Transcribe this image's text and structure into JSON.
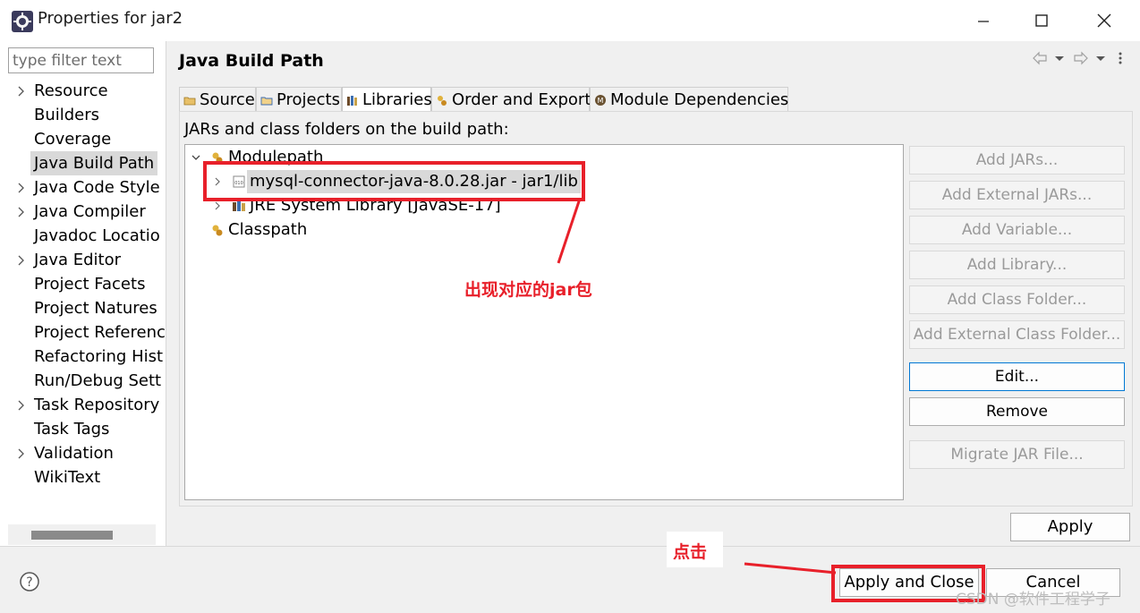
{
  "window": {
    "title": "Properties for jar2",
    "icons": [
      "eclipse-icon",
      "minimize-icon",
      "maximize-icon",
      "close-icon"
    ]
  },
  "nav": {
    "filter_placeholder": "type filter text",
    "items": [
      {
        "label": "Resource",
        "expandable": true
      },
      {
        "label": "Builders",
        "expandable": false
      },
      {
        "label": "Coverage",
        "expandable": false
      },
      {
        "label": "Java Build Path",
        "expandable": false,
        "selected": true
      },
      {
        "label": "Java Code Style",
        "expandable": true
      },
      {
        "label": "Java Compiler",
        "expandable": true
      },
      {
        "label": "Javadoc Locatio",
        "expandable": false
      },
      {
        "label": "Java Editor",
        "expandable": true
      },
      {
        "label": "Project Facets",
        "expandable": false
      },
      {
        "label": "Project Natures",
        "expandable": false
      },
      {
        "label": "Project Referenc",
        "expandable": false
      },
      {
        "label": "Refactoring Hist",
        "expandable": false
      },
      {
        "label": "Run/Debug Sett",
        "expandable": false
      },
      {
        "label": "Task Repository",
        "expandable": true
      },
      {
        "label": "Task Tags",
        "expandable": false
      },
      {
        "label": "Validation",
        "expandable": true
      },
      {
        "label": "WikiText",
        "expandable": false
      }
    ]
  },
  "page": {
    "title": "Java Build Path",
    "history_icons": [
      "back-arrow-icon",
      "dropdown-icon",
      "forward-arrow-icon",
      "dropdown-icon",
      "view-menu-icon"
    ],
    "tabs": [
      {
        "label": "Source",
        "icon": "source-folder-icon"
      },
      {
        "label": "Projects",
        "icon": "project-folder-icon"
      },
      {
        "label": "Libraries",
        "icon": "library-icon",
        "active": true
      },
      {
        "label": "Order and Export",
        "icon": "order-export-icon"
      },
      {
        "label": "Module Dependencies",
        "icon": "module-icon"
      }
    ],
    "section_label": "JARs and class folders on the build path:",
    "tree": {
      "modulepath": "Modulepath",
      "jar": "mysql-connector-java-8.0.28.jar - jar1/lib",
      "jre": "JRE System Library [JavaSE-17]",
      "classpath": "Classpath"
    },
    "buttons": {
      "add_jars": "Add JARs...",
      "add_external_jars": "Add External JARs...",
      "add_variable": "Add Variable...",
      "add_library": "Add Library...",
      "add_class_folder": "Add Class Folder...",
      "add_external_class_folder": "Add External Class Folder...",
      "edit": "Edit...",
      "remove": "Remove",
      "migrate_jar": "Migrate JAR File...",
      "apply": "Apply"
    }
  },
  "footer": {
    "help_icon": "help-icon",
    "apply_and_close": "Apply and Close",
    "cancel": "Cancel"
  },
  "annotations": {
    "jar_note": "出现对应的jar包",
    "click_note": "点击",
    "color": "#e8202a"
  },
  "watermark": "CSDN @软件工程学子"
}
